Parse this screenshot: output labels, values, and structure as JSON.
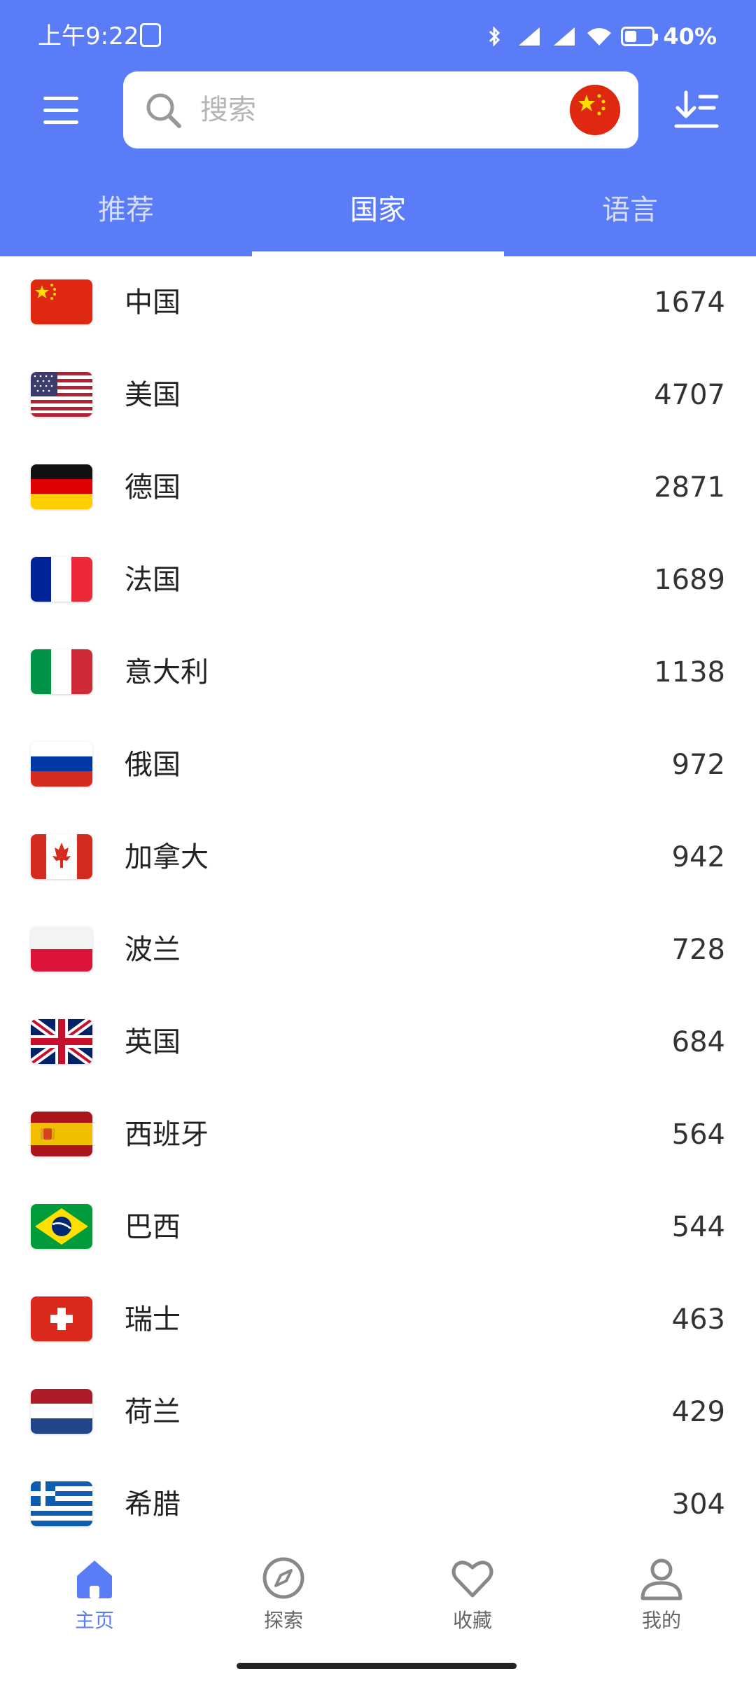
{
  "status": {
    "time": "上午9:22",
    "battery": "40%"
  },
  "search": {
    "placeholder": "搜索"
  },
  "tabs": [
    {
      "label": "推荐",
      "active": false
    },
    {
      "label": "国家",
      "active": true
    },
    {
      "label": "语言",
      "active": false
    }
  ],
  "countries": [
    {
      "name": "中国",
      "count": "1674",
      "flag": "cn-flag-icon"
    },
    {
      "name": "美国",
      "count": "4707",
      "flag": "us-flag-icon"
    },
    {
      "name": "德国",
      "count": "2871",
      "flag": "de-flag-icon"
    },
    {
      "name": "法国",
      "count": "1689",
      "flag": "fr-flag-icon"
    },
    {
      "name": "意大利",
      "count": "1138",
      "flag": "it-flag-icon"
    },
    {
      "name": "俄国",
      "count": "972",
      "flag": "ru-flag-icon"
    },
    {
      "name": "加拿大",
      "count": "942",
      "flag": "ca-flag-icon"
    },
    {
      "name": "波兰",
      "count": "728",
      "flag": "pl-flag-icon"
    },
    {
      "name": "英国",
      "count": "684",
      "flag": "gb-flag-icon"
    },
    {
      "name": "西班牙",
      "count": "564",
      "flag": "es-flag-icon"
    },
    {
      "name": "巴西",
      "count": "544",
      "flag": "br-flag-icon"
    },
    {
      "name": "瑞士",
      "count": "463",
      "flag": "ch-flag-icon"
    },
    {
      "name": "荷兰",
      "count": "429",
      "flag": "nl-flag-icon"
    },
    {
      "name": "希腊",
      "count": "304",
      "flag": "gr-flag-icon"
    }
  ],
  "nav": [
    {
      "label": "主页",
      "icon": "home-icon",
      "active": true
    },
    {
      "label": "探索",
      "icon": "compass-icon",
      "active": false
    },
    {
      "label": "收藏",
      "icon": "heart-icon",
      "active": false
    },
    {
      "label": "我的",
      "icon": "user-icon",
      "active": false
    }
  ],
  "colors": {
    "primary": "#5B7CF7",
    "inactive": "#888888"
  }
}
